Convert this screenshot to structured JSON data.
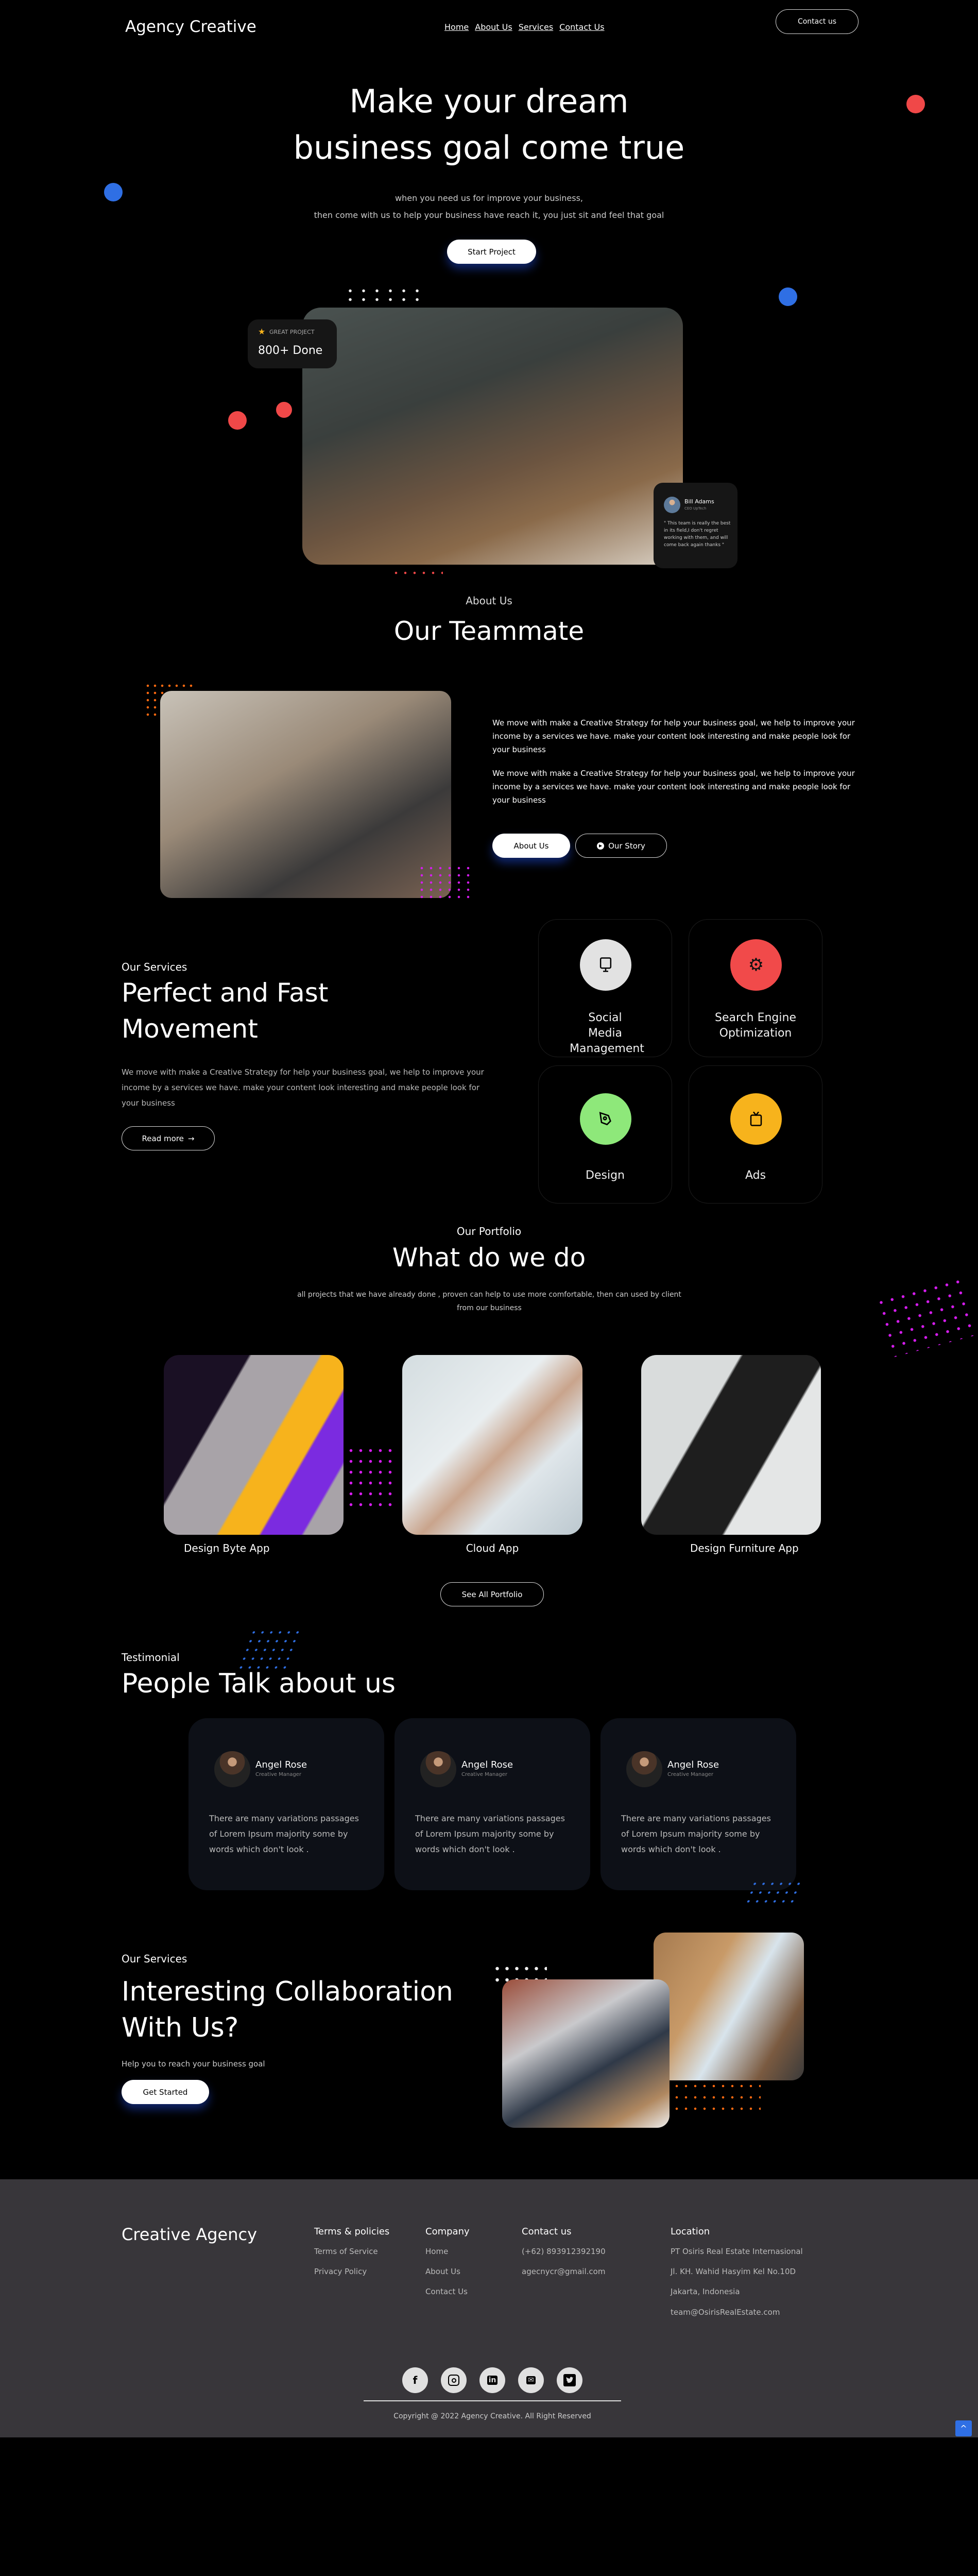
{
  "nav": {
    "logo": "Agency Creative",
    "links": [
      "Home",
      "About Us",
      "Services",
      "Contact Us"
    ],
    "contact_button": "Contact us"
  },
  "hero": {
    "title_line1": "Make your dream",
    "title_line2": "business goal come true",
    "subtitle_line1": "when you need us for improve your business,",
    "subtitle_line2": "then come with us to help your business have reach it, you just sit and feel that goal",
    "cta": "Start Project",
    "badge": {
      "label": "GREAT PROJECT",
      "value": "800+ Done"
    },
    "review": {
      "name": "Bill Adams",
      "role": "CEO UpTech",
      "quote": "\" This team is really the best in its field,I don't regret working with them, and will come back again thanks \""
    }
  },
  "about": {
    "eyebrow": "About Us",
    "title": "Our Teammate",
    "paragraphs": [
      "We move with make a Creative Strategy for help your business goal, we help to improve your income by a services we have. make your content look interesting and make people look for your business",
      "We move with make a Creative Strategy for help your business goal, we help to improve your income by a services we have. make your content look interesting and make people look for your business"
    ],
    "primary_button": "About Us",
    "secondary_button": "Our Story"
  },
  "services": {
    "eyebrow": "Our Services",
    "title_line1": "Perfect and Fast",
    "title_line2": "Movement",
    "description": "We move with make a Creative Strategy for help your business goal, we help to improve your income by a services we have. make your content look interesting and make people look for your business",
    "read_more": "Read more",
    "items": [
      {
        "label": "Social Media Management",
        "icon": "monitor-icon",
        "color": "#e2e2e2"
      },
      {
        "label": "Search Engine Optimization",
        "icon": "gear-icon",
        "color": "#f14a4a"
      },
      {
        "label": "Design",
        "icon": "pen-tool-icon",
        "color": "#8ee87a"
      },
      {
        "label": "Ads",
        "icon": "tv-icon",
        "color": "#f7b31c"
      }
    ]
  },
  "portfolio": {
    "eyebrow": "Our Portfolio",
    "title": "What do we do",
    "description": "all projects that we have already done , proven can help to use more comfortable, then can used by client from our business",
    "items": [
      "Design Byte App",
      "Cloud App",
      "Design Furniture App"
    ],
    "see_all": "See All Portfolio"
  },
  "testimonial": {
    "eyebrow": "Testimonial",
    "title": "People Talk about us",
    "cards": [
      {
        "name": "Angel Rose",
        "role": "Creative Manager",
        "text": "There are many variations passages of Lorem Ipsum majority some by words which don't look ."
      },
      {
        "name": "Angel Rose",
        "role": "Creative Manager",
        "text": "There are many variations passages of Lorem Ipsum majority some by words which don't look ."
      },
      {
        "name": "Angel Rose",
        "role": "Creative Manager",
        "text": "There are many variations passages of Lorem Ipsum majority some by words which don't look ."
      }
    ]
  },
  "collab": {
    "eyebrow": "Our Services",
    "title_line1": "Interesting Collaboration",
    "title_line2": "With Us?",
    "subtitle": "Help you to reach your business goal",
    "cta": "Get Started"
  },
  "footer": {
    "brand": "Creative Agency",
    "terms": {
      "title": "Terms & policies",
      "items": [
        "Terms of Service",
        "Privacy Policy"
      ]
    },
    "company": {
      "title": "Company",
      "items": [
        "Home",
        "About Us",
        "Contact Us"
      ]
    },
    "contact": {
      "title": "Contact us",
      "items": [
        "(+62) 893912392190",
        "agecnycr@gmail.com"
      ]
    },
    "location": {
      "title": "Location",
      "items": [
        "PT Osiris Real Estate Internasional",
        "Jl. KH. Wahid Hasyim Kel No.10D",
        "Jakarta, Indonesia",
        "team@OsirisRealEstate.com"
      ]
    },
    "social": [
      "f",
      "ig",
      "in",
      "mail",
      "tw"
    ],
    "copyright": "Copyright @ 2022 Agency Creative. All Right Reserved",
    "scroll_top": "^"
  },
  "colors": {
    "accent_blue": "#2f6fe4",
    "red": "#f04848",
    "magenta": "#d61cf0",
    "orange": "#ff6a10",
    "footer_bg": "#38363a"
  }
}
